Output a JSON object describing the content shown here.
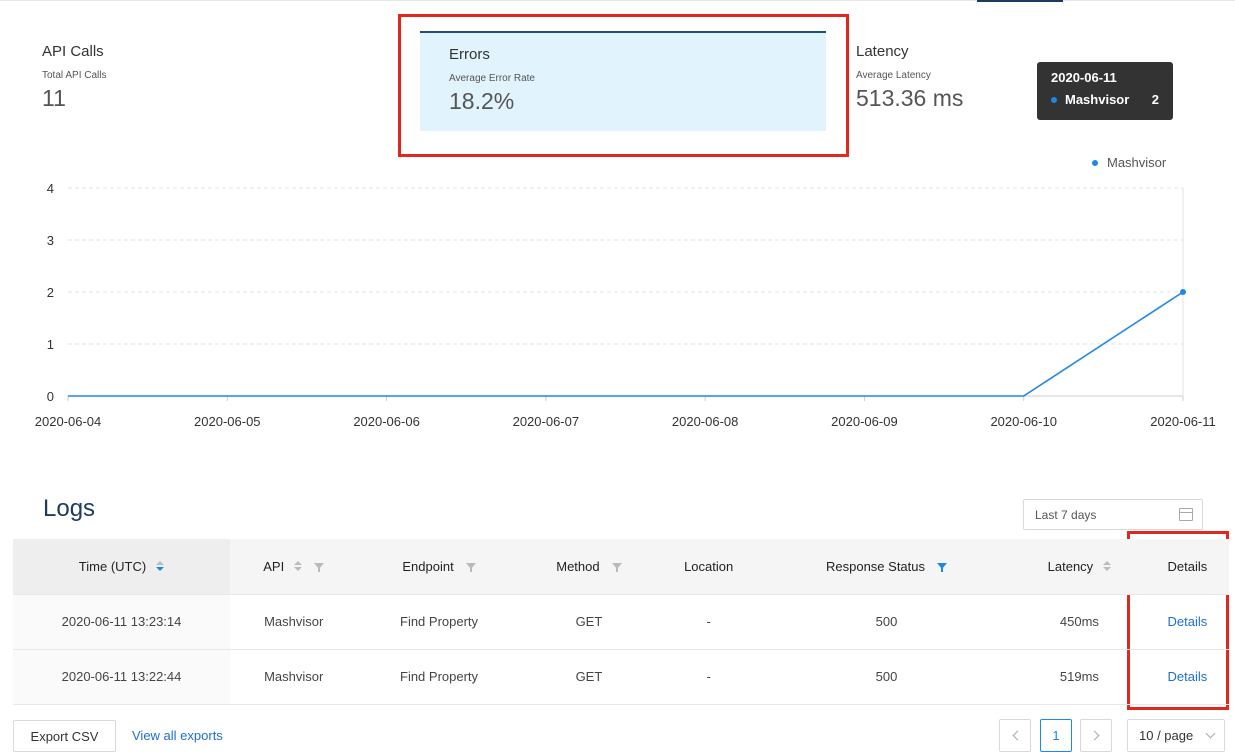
{
  "metrics": {
    "api_calls": {
      "title": "API Calls",
      "subtitle": "Total API Calls",
      "value": "11"
    },
    "errors": {
      "title": "Errors",
      "subtitle": "Average Error Rate",
      "value": "18.2%"
    },
    "latency": {
      "title": "Latency",
      "subtitle": "Average Latency",
      "value": "513.36 ms"
    }
  },
  "tooltip": {
    "date": "2020-06-11",
    "series": "Mashvisor",
    "value": "2"
  },
  "colors": {
    "series": "#1e88e5",
    "highlight": "#e0281f",
    "accent": "#1d3a5f"
  },
  "chart_data": {
    "type": "line",
    "x": [
      "2020-06-04",
      "2020-06-05",
      "2020-06-06",
      "2020-06-07",
      "2020-06-08",
      "2020-06-09",
      "2020-06-10",
      "2020-06-11"
    ],
    "series": [
      {
        "name": "Mashvisor",
        "values": [
          0,
          0,
          0,
          0,
          0,
          0,
          0,
          2
        ]
      }
    ],
    "ylim": [
      0,
      4
    ],
    "yticks": [
      "0",
      "1",
      "2",
      "3",
      "4"
    ],
    "grid": true,
    "legend": "top-right"
  },
  "logs": {
    "title": "Logs",
    "date_range": "Last 7 days",
    "columns": [
      "Time (UTC)",
      "API",
      "Endpoint",
      "Method",
      "Location",
      "Response Status",
      "Latency",
      "Details"
    ],
    "rows": [
      {
        "time": "2020-06-11 13:23:14",
        "api": "Mashvisor",
        "endpoint": "Find Property",
        "method": "GET",
        "location": "-",
        "status": "500",
        "latency": "450ms",
        "details": "Details"
      },
      {
        "time": "2020-06-11 13:22:44",
        "api": "Mashvisor",
        "endpoint": "Find Property",
        "method": "GET",
        "location": "-",
        "status": "500",
        "latency": "519ms",
        "details": "Details"
      }
    ]
  },
  "footer": {
    "export_label": "Export CSV",
    "view_exports_label": "View all exports",
    "current_page": "1",
    "page_size": "10 / page"
  }
}
